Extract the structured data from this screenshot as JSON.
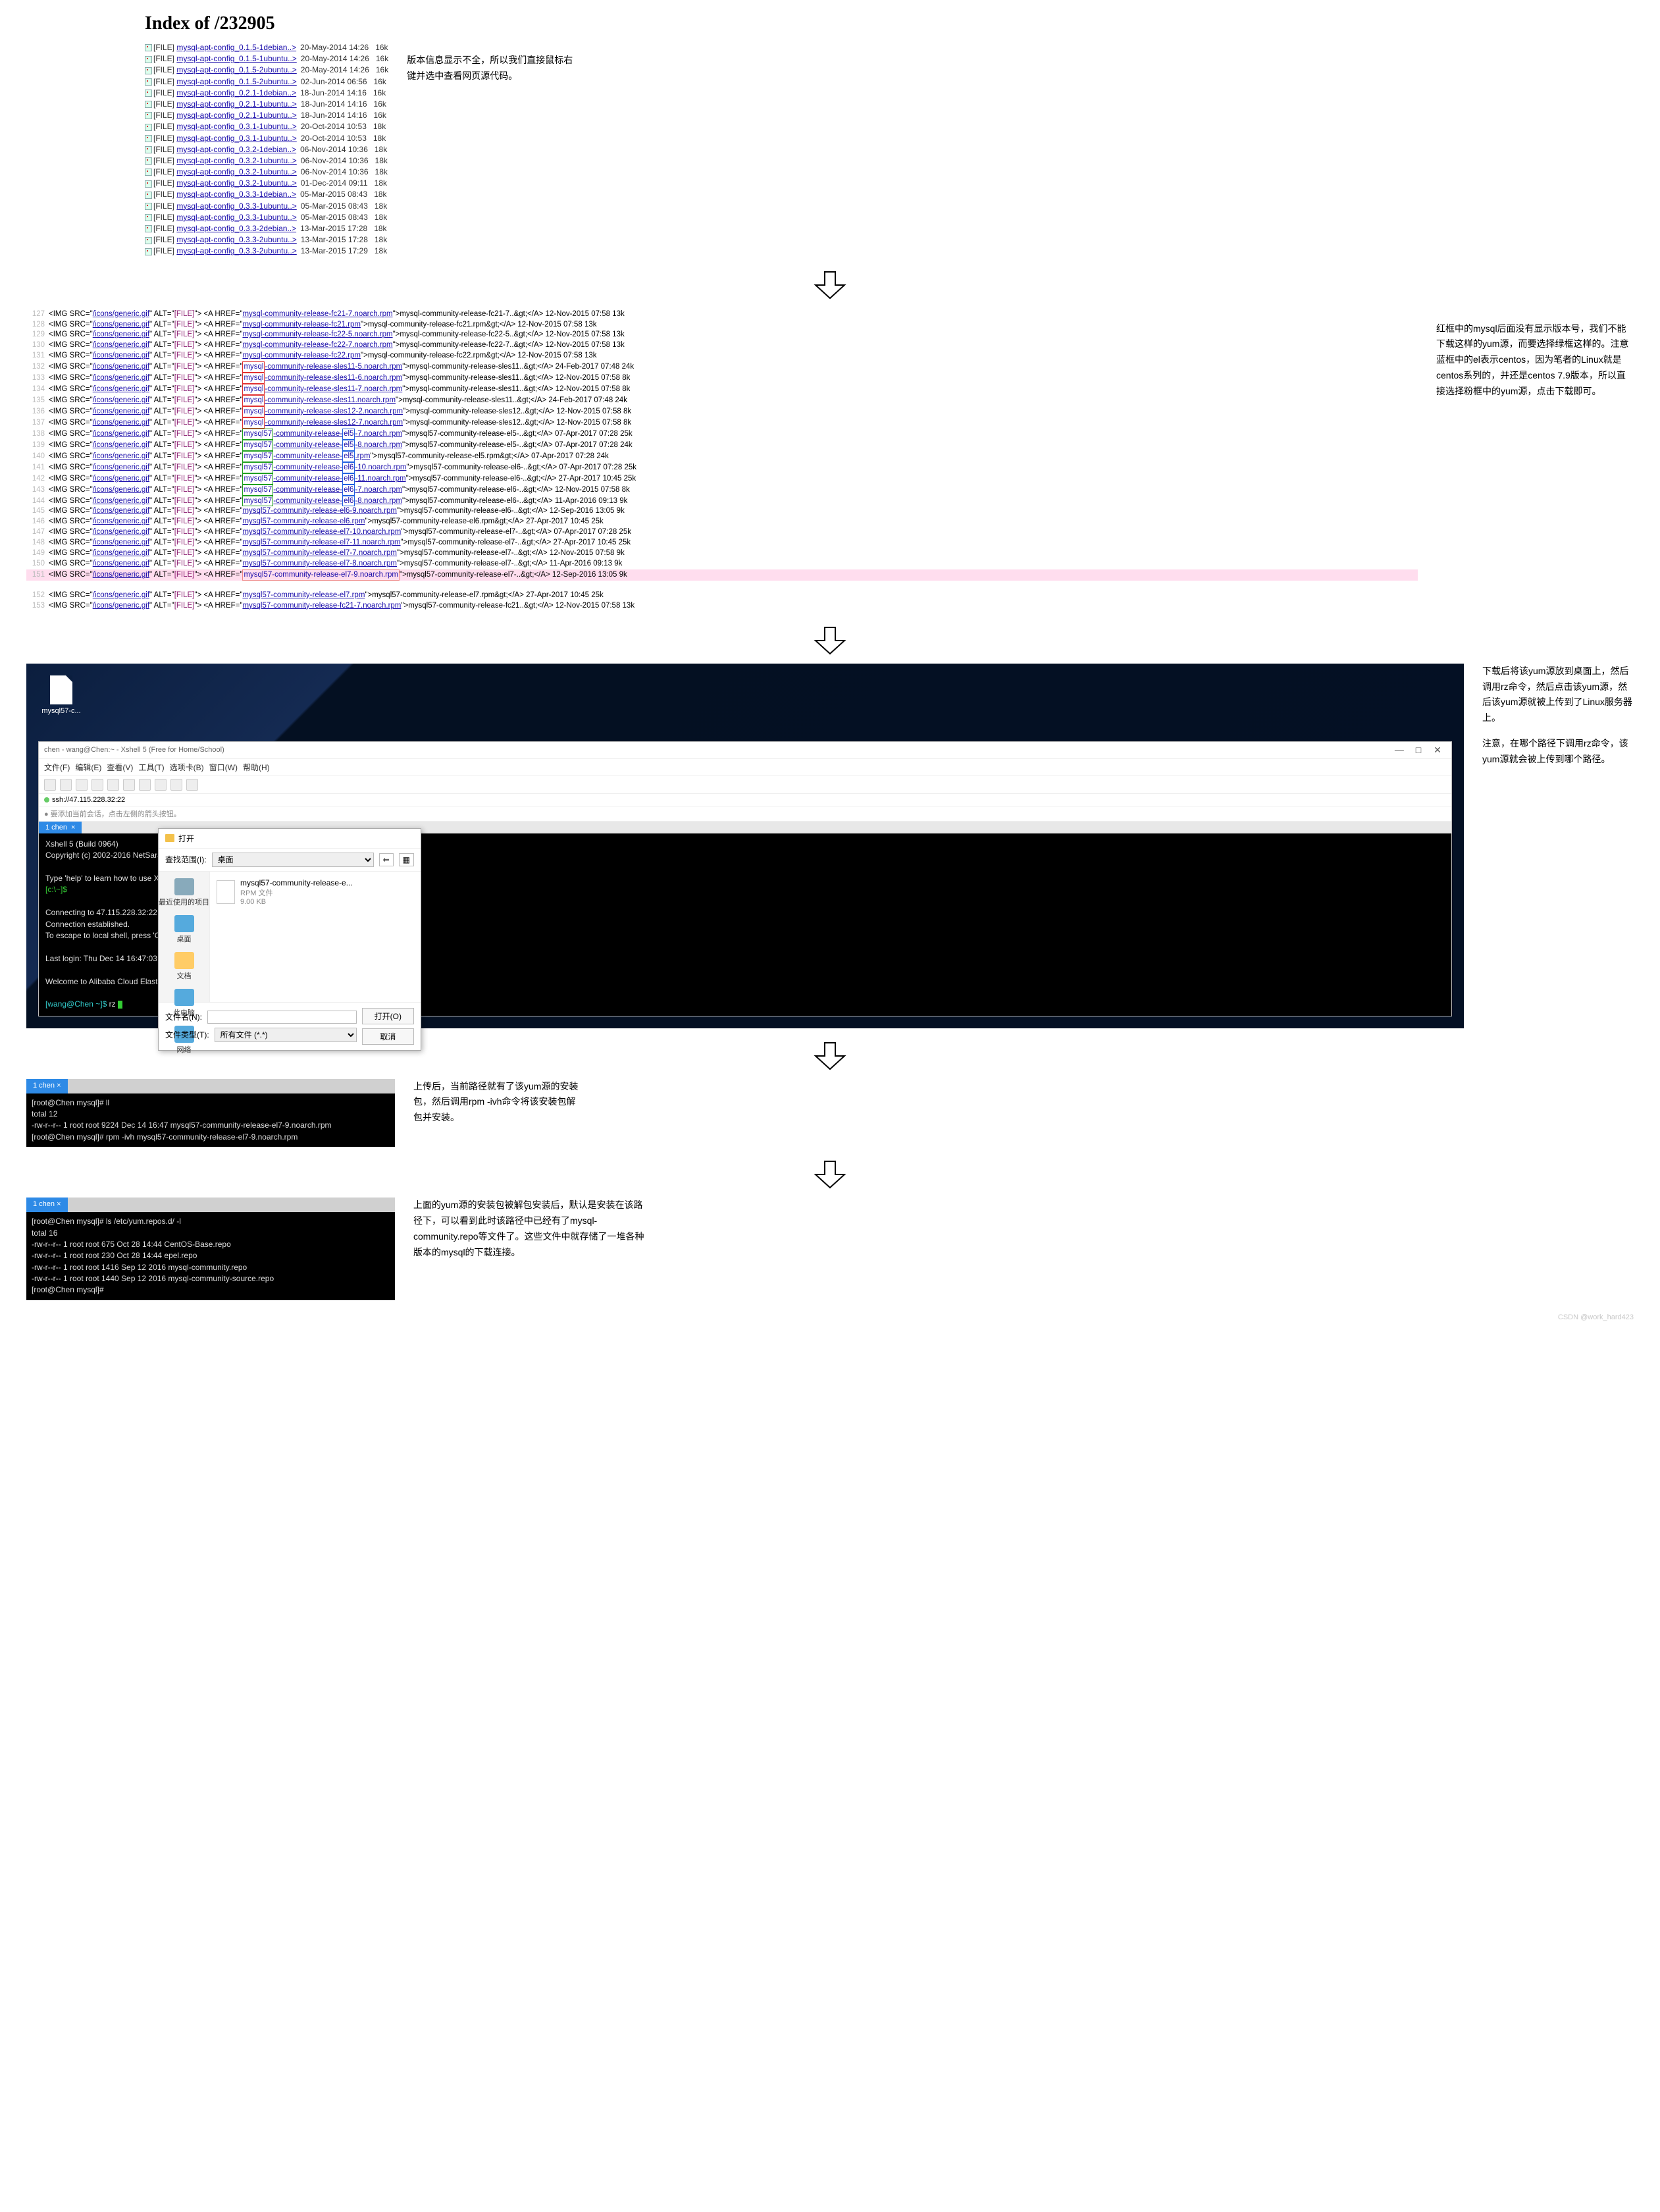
{
  "index": {
    "title": "Index of /232905",
    "rows": [
      {
        "name": "mysql-apt-config_0.1.5-1debian..>",
        "date": "20-May-2014 14:26",
        "size": "16k"
      },
      {
        "name": "mysql-apt-config_0.1.5-1ubuntu..>",
        "date": "20-May-2014 14:26",
        "size": "16k"
      },
      {
        "name": "mysql-apt-config_0.1.5-2ubuntu..>",
        "date": "20-May-2014 14:26",
        "size": "16k"
      },
      {
        "name": "mysql-apt-config_0.1.5-2ubuntu..>",
        "date": "02-Jun-2014 06:56",
        "size": "16k"
      },
      {
        "name": "mysql-apt-config_0.2.1-1debian..>",
        "date": "18-Jun-2014 14:16",
        "size": "16k"
      },
      {
        "name": "mysql-apt-config_0.2.1-1ubuntu..>",
        "date": "18-Jun-2014 14:16",
        "size": "16k"
      },
      {
        "name": "mysql-apt-config_0.2.1-1ubuntu..>",
        "date": "18-Jun-2014 14:16",
        "size": "16k"
      },
      {
        "name": "mysql-apt-config_0.3.1-1ubuntu..>",
        "date": "20-Oct-2014 10:53",
        "size": "18k"
      },
      {
        "name": "mysql-apt-config_0.3.1-1ubuntu..>",
        "date": "20-Oct-2014 10:53",
        "size": "18k"
      },
      {
        "name": "mysql-apt-config_0.3.2-1debian..>",
        "date": "06-Nov-2014 10:36",
        "size": "18k"
      },
      {
        "name": "mysql-apt-config_0.3.2-1ubuntu..>",
        "date": "06-Nov-2014 10:36",
        "size": "18k"
      },
      {
        "name": "mysql-apt-config_0.3.2-1ubuntu..>",
        "date": "06-Nov-2014 10:36",
        "size": "18k"
      },
      {
        "name": "mysql-apt-config_0.3.2-1ubuntu..>",
        "date": "01-Dec-2014 09:11",
        "size": "18k"
      },
      {
        "name": "mysql-apt-config_0.3.3-1debian..>",
        "date": "05-Mar-2015 08:43",
        "size": "18k"
      },
      {
        "name": "mysql-apt-config_0.3.3-1ubuntu..>",
        "date": "05-Mar-2015 08:43",
        "size": "18k"
      },
      {
        "name": "mysql-apt-config_0.3.3-1ubuntu..>",
        "date": "05-Mar-2015 08:43",
        "size": "18k"
      },
      {
        "name": "mysql-apt-config_0.3.3-2debian..>",
        "date": "13-Mar-2015 17:28",
        "size": "18k"
      },
      {
        "name": "mysql-apt-config_0.3.3-2ubuntu..>",
        "date": "13-Mar-2015 17:28",
        "size": "18k"
      },
      {
        "name": "mysql-apt-config_0.3.3-2ubuntu..>",
        "date": "13-Mar-2015 17:29",
        "size": "18k"
      }
    ],
    "annotation": "版本信息显示不全，所以我们直接鼠标右键并选中查看网页源代码。"
  },
  "source": {
    "annotation": "红框中的mysql后面没有显示版本号，我们不能下载这样的yum源，而要选择绿框这样的。注意蓝框中的el表示centos，因为笔者的Linux就是centos系列的，并还是centos 7.9版本，所以直接选择粉框中的yum源，点击下载即可。",
    "lines": [
      {
        "n": 127,
        "href": "mysql-community-release-fc21-7.noarch.rpm",
        "txt": "mysql-community-release-fc21-7..",
        "date": "12-Nov-2015 07:58",
        "size": "13k"
      },
      {
        "n": 128,
        "href": "mysql-community-release-fc21.rpm",
        "txt": "mysql-community-release-fc21.rpm",
        "date": "12-Nov-2015 07:58",
        "size": "13k"
      },
      {
        "n": 129,
        "href": "mysql-community-release-fc22-5.noarch.rpm",
        "txt": "mysql-community-release-fc22-5..",
        "date": "12-Nov-2015 07:58",
        "size": "13k"
      },
      {
        "n": 130,
        "href": "mysql-community-release-fc22-7.noarch.rpm",
        "txt": "mysql-community-release-fc22-7..",
        "date": "12-Nov-2015 07:58",
        "size": "13k"
      },
      {
        "n": 131,
        "href": "mysql-community-release-fc22.rpm",
        "txt": "mysql-community-release-fc22.rpm",
        "date": "12-Nov-2015 07:58",
        "size": "13k"
      },
      {
        "n": 132,
        "box": "red",
        "p1": "mysql",
        "p2": "-community-release-sles11-5.noarch.rpm",
        "txt": "mysql-community-release-sles11..",
        "date": "24-Feb-2017 07:48",
        "size": "24k"
      },
      {
        "n": 133,
        "box": "red",
        "p1": "mysql",
        "p2": "-community-release-sles11-6.noarch.rpm",
        "txt": "mysql-community-release-sles11..",
        "date": "12-Nov-2015 07:58",
        "size": "8k"
      },
      {
        "n": 134,
        "box": "red",
        "p1": "mysql",
        "p2": "-community-release-sles11-7.noarch.rpm",
        "txt": "mysql-community-release-sles11..",
        "date": "12-Nov-2015 07:58",
        "size": "8k"
      },
      {
        "n": 135,
        "box": "red",
        "p1": "mysql",
        "p2": "-community-release-sles11.noarch.rpm",
        "txt": "mysql-community-release-sles11..",
        "date": "24-Feb-2017 07:48",
        "size": "24k"
      },
      {
        "n": 136,
        "box": "red",
        "p1": "mysql",
        "p2": "-community-release-sles12-2.noarch.rpm",
        "txt": "mysql-community-release-sles12..",
        "date": "12-Nov-2015 07:58",
        "size": "8k"
      },
      {
        "n": 137,
        "box": "red",
        "p1": "mysql",
        "p2": "-community-release-sles12-7.noarch.rpm",
        "txt": "mysql-community-release-sles12..",
        "date": "12-Nov-2015 07:58",
        "size": "8k"
      },
      {
        "n": 138,
        "box": "green",
        "p1": "mysql57",
        "p2": "-community-release-",
        "pblue": "el5",
        "p3": "-7.noarch.rpm",
        "txt": "mysql57-community-release-el5-..",
        "date": "07-Apr-2017 07:28",
        "size": "25k"
      },
      {
        "n": 139,
        "box": "green",
        "p1": "mysql57",
        "p2": "-community-release-",
        "pblue": "el5",
        "p3": "-8.noarch.rpm",
        "txt": "mysql57-community-release-el5-..",
        "date": "07-Apr-2017 07:28",
        "size": "24k"
      },
      {
        "n": 140,
        "box": "green",
        "p1": "mysql57",
        "p2": "-community-release-",
        "pblue": "el5",
        "p3": ".rpm",
        "txt": "mysql57-community-release-el5.rpm",
        "date": "07-Apr-2017 07:28",
        "size": "24k"
      },
      {
        "n": 141,
        "box": "green",
        "p1": "mysql57",
        "p2": "-community-release-",
        "pblue": "el6",
        "p3": "-10.noarch.rpm",
        "txt": "mysql57-community-release-el6-..",
        "date": "07-Apr-2017 07:28",
        "size": "25k"
      },
      {
        "n": 142,
        "box": "green",
        "p1": "mysql57",
        "p2": "-community-release-",
        "pblue": "el6",
        "p3": "-11.noarch.rpm",
        "txt": "mysql57-community-release-el6-..",
        "date": "27-Apr-2017 10:45",
        "size": "25k"
      },
      {
        "n": 143,
        "box": "green",
        "p1": "mysql57",
        "p2": "-community-release-",
        "pblue": "el6",
        "p3": "-7.noarch.rpm",
        "txt": "mysql57-community-release-el6-..",
        "date": "12-Nov-2015 07:58",
        "size": "8k"
      },
      {
        "n": 144,
        "box": "green",
        "p1": "mysql57",
        "p2": "-community-release-",
        "pblue": "el6",
        "p3": "-8.noarch.rpm",
        "txt": "mysql57-community-release-el6-..",
        "date": "11-Apr-2016 09:13",
        "size": "9k"
      },
      {
        "n": 145,
        "href": "mysql57-community-release-el6-9.noarch.rpm",
        "txt": "mysql57-community-release-el6-..",
        "date": "12-Sep-2016 13:05",
        "size": "9k"
      },
      {
        "n": 146,
        "href": "mysql57-community-release-el6.rpm",
        "txt": "mysql57-community-release-el6.rpm",
        "date": "27-Apr-2017 10:45",
        "size": "25k"
      },
      {
        "n": 147,
        "href": "mysql57-community-release-el7-10.noarch.rpm",
        "txt": "mysql57-community-release-el7-..",
        "date": "07-Apr-2017 07:28",
        "size": "25k"
      },
      {
        "n": 148,
        "href": "mysql57-community-release-el7-11.noarch.rpm",
        "txt": "mysql57-community-release-el7-..",
        "date": "27-Apr-2017 10:45",
        "size": "25k"
      },
      {
        "n": 149,
        "href": "mysql57-community-release-el7-7.noarch.rpm",
        "txt": "mysql57-community-release-el7-..",
        "date": "12-Nov-2015 07:58",
        "size": "9k"
      },
      {
        "n": 150,
        "href": "mysql57-community-release-el7-8.noarch.rpm",
        "txt": "mysql57-community-release-el7-..",
        "date": "11-Apr-2016 09:13",
        "size": "9k"
      },
      {
        "n": 151,
        "pink": true,
        "href": "mysql57-community-release-el7-9.noarch.rpm",
        "txt": "mysql57-community-release-el7-..",
        "date": "12-Sep-2016 13:05",
        "size": "9k"
      },
      {
        "n": 152,
        "href": "mysql57-community-release-el7.rpm",
        "txt": "mysql57-community-release-el7.rpm",
        "date": "27-Apr-2017 10:45",
        "size": "25k"
      },
      {
        "n": 153,
        "href": "mysql57-community-release-fc21-7.noarch.rpm",
        "txt": "mysql57-community-release-fc21..",
        "date": "12-Nov-2015 07:58",
        "size": "13k"
      }
    ]
  },
  "desktop": {
    "icon_label": "mysql57-c...",
    "xshell": {
      "title": "chen - wang@Chen:~ - Xshell 5 (Free for Home/School)",
      "menus": [
        "文件(F)",
        "编辑(E)",
        "查看(V)",
        "工具(T)",
        "选项卡(B)",
        "窗口(W)",
        "帮助(H)"
      ],
      "addr": "ssh://47.115.228.32:22",
      "hint": "● 要添加当前会话，点击左侧的箭头按钮。",
      "tab": "1 chen",
      "term": [
        "Xshell 5 (Build 0964)",
        "Copyright (c) 2002-2016 NetSarang Computer, Inc. All rights reserved.",
        "",
        "Type 'help' to learn how to use Xshell prompt.",
        "[c:\\~]$ ",
        "",
        "Connecting to 47.115.228.32:22...",
        "Connection established.",
        "To escape to local shell, press 'Ctrl+Alt+]'.",
        "",
        "Last login: Thu Dec 14 16:47:03 2023 from 223.104.68.59",
        "",
        "Welcome to Alibaba Cloud Elastic Compute Service !",
        "",
        "[wang@Chen ~]$ rz "
      ]
    },
    "dialog": {
      "title": "打开",
      "lookin_label": "查找范围(I):",
      "lookin_value": "桌面",
      "file_name": "mysql57-community-release-e...",
      "file_sub": "RPM 文件",
      "file_size": "9.00 KB",
      "side": [
        "最近使用的项目",
        "桌面",
        "文档",
        "此电脑",
        "网络"
      ],
      "fn_label": "文件名(N):",
      "ft_label": "文件类型(T):",
      "ft_value": "所有文件 (*.*)",
      "open": "打开(O)",
      "cancel": "取消"
    },
    "annotation1": "下载后将该yum源放到桌面上，然后调用rz命令，然后点击该yum源，然后该yum源就被上传到了Linux服务器上。",
    "annotation2": "注意，在哪个路径下调用rz命令，该yum源就会被上传到哪个路径。"
  },
  "term2": {
    "tab": "1 chen",
    "lines": [
      {
        "t": "[root@Chen mysql]# ll",
        "c": "w"
      },
      {
        "t": "total 12",
        "c": "w"
      },
      {
        "t": "-rw-r--r-- 1 root root 9224 Dec 14 16:47 ",
        "c": "w",
        "suffix": "mysql57-community-release-el7-9.noarch.rpm",
        "sc": "red"
      },
      {
        "t": "[root@Chen mysql]# rpm -ivh mysql57-community-release-el7-9.noarch.rpm",
        "c": "w",
        "cursor": true
      }
    ],
    "annotation": "上传后，当前路径就有了该yum源的安装包，然后调用rpm  -ivh命令将该安装包解包并安装。"
  },
  "term3": {
    "tab": "1 chen",
    "lines": [
      "[root@Chen mysql]# ls /etc/yum.repos.d/ -l",
      "total 16",
      "-rw-r--r-- 1 root root  675 Oct 28 14:44 CentOS-Base.repo",
      "-rw-r--r-- 1 root root  230 Oct 28 14:44 epel.repo",
      "-rw-r--r-- 1 root root 1416 Sep 12  2016 mysql-community.repo",
      "-rw-r--r-- 1 root root 1440 Sep 12  2016 mysql-community-source.repo",
      "[root@Chen mysql]# "
    ],
    "annotation": "上面的yum源的安装包被解包安装后，默认是安装在该路径下，可以看到此时该路径中已经有了mysql-community.repo等文件了。这些文件中就存储了一堆各种版本的mysql的下载连接。"
  },
  "watermark": "CSDN @work_hard423"
}
